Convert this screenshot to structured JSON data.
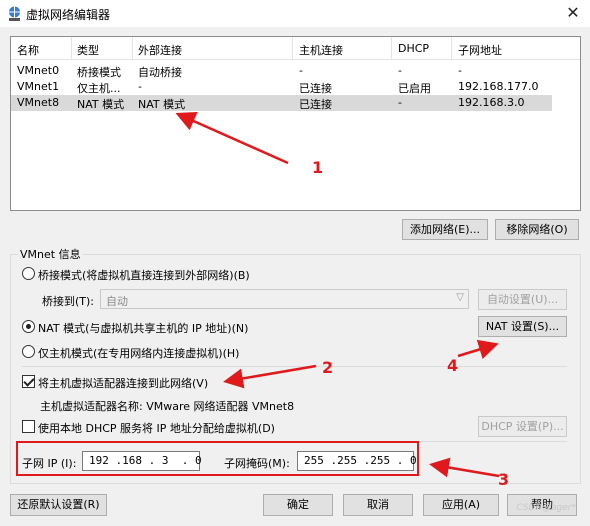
{
  "window": {
    "title": "虚拟网络编辑器",
    "close_glyph": "✕"
  },
  "table": {
    "columns": [
      "名称",
      "类型",
      "外部连接",
      "主机连接",
      "DHCP",
      "子网地址"
    ],
    "rows": [
      {
        "name": "VMnet0",
        "type": "桥接模式",
        "external": "自动桥接",
        "host": "-",
        "dhcp": "-",
        "subnet": "-",
        "selected": false
      },
      {
        "name": "VMnet1",
        "type": "仅主机...",
        "external": "-",
        "host": "已连接",
        "dhcp": "已启用",
        "subnet": "192.168.177.0",
        "selected": false
      },
      {
        "name": "VMnet8",
        "type": "NAT 模式",
        "external": "NAT 模式",
        "host": "已连接",
        "dhcp": "-",
        "subnet": "192.168.3.0",
        "selected": true
      }
    ]
  },
  "buttons": {
    "add_network": "添加网络(E)...",
    "remove_network": "移除网络(O)",
    "auto_settings": "自动设置(U)...",
    "nat_settings": "NAT 设置(S)...",
    "dhcp_settings": "DHCP 设置(P)...",
    "restore_defaults": "还原默认设置(R)",
    "ok": "确定",
    "cancel": "取消",
    "apply": "应用(A)",
    "help": "帮助"
  },
  "vmnet_info": {
    "group_title": "VMnet 信息",
    "bridged_mode": "桥接模式(将虚拟机直接连接到外部网络)(B)",
    "bridge_to_label": "桥接到(T):",
    "bridge_to_value": "自动",
    "nat_mode": "NAT 模式(与虚拟机共享主机的 IP 地址)(N)",
    "host_only_mode": "仅主机模式(在专用网络内连接虚拟机)(H)",
    "selected_mode": "nat",
    "connect_adapter": "将主机虚拟适配器连接到此网络(V)",
    "connect_adapter_checked": true,
    "adapter_name_label": "主机虚拟适配器名称: VMware 网络适配器 VMnet8",
    "use_dhcp": "使用本地 DHCP 服务将 IP 地址分配给虚拟机(D)",
    "use_dhcp_checked": false,
    "subnet_ip_label": "子网 IP (I):",
    "subnet_ip_value": "192 .168 . 3  . 0",
    "subnet_mask_label": "子网掩码(M):",
    "subnet_mask_value": "255 .255 .255 . 0"
  },
  "annotations": {
    "n1": "1",
    "n2": "2",
    "n3": "3",
    "n4": "4",
    "color": "#e0191c"
  },
  "watermark": "CSDN@ager*"
}
